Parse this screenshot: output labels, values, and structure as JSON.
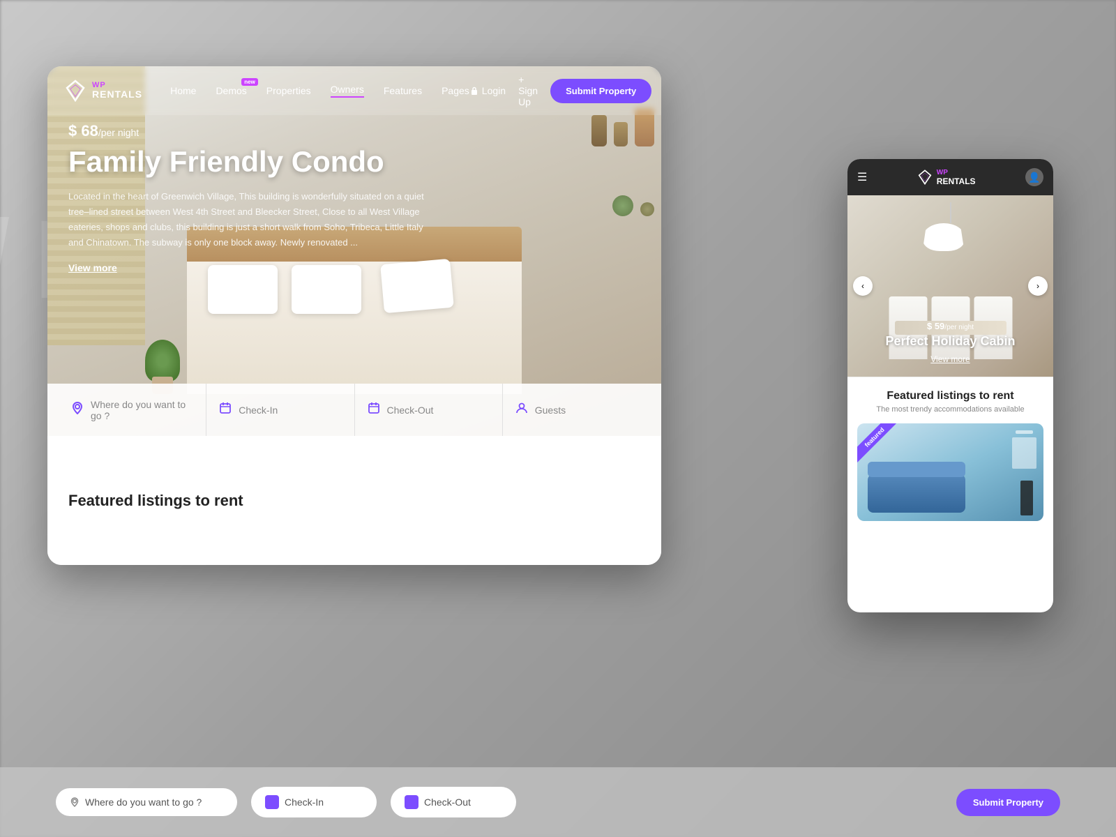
{
  "background": {
    "text": "/ F"
  },
  "nav": {
    "logo": {
      "wp": "WP",
      "rentals": "RENTALS"
    },
    "links": [
      {
        "label": "Home",
        "active": false
      },
      {
        "label": "Demos",
        "active": false,
        "badge": "new"
      },
      {
        "label": "Properties",
        "active": false
      },
      {
        "label": "Owners",
        "active": true
      },
      {
        "label": "Features",
        "active": false
      },
      {
        "label": "Pages",
        "active": false
      }
    ],
    "login_label": "Login",
    "signup_label": "+ Sign Up",
    "submit_label": "Submit Property"
  },
  "hero": {
    "price": "$ 68",
    "price_unit": "/per night",
    "title": "Family Friendly Condo",
    "description": "Located in the heart of Greenwich Village, This building is wonderfully situated on a quiet tree–lined street between West 4th Street and Bleecker Street, Close to all West Village eateries, shops and clubs, this building is just a short walk from Soho, Tribeca, Little Italy and Chinatown. The subway is only one block away. Newly renovated ...",
    "view_more": "View more"
  },
  "search": {
    "location_placeholder": "Where do you want to go ?",
    "checkin_label": "Check-In",
    "checkout_label": "Check-Out",
    "guests_label": "Guests"
  },
  "featured": {
    "title": "Featured listings to rent"
  },
  "mobile": {
    "nav": {
      "wp": "WP",
      "rentals": "RENTALS"
    },
    "hero": {
      "price": "$ 59",
      "price_unit": "/per night",
      "title": "Perfect Holiday Cabin",
      "view_more": "View more"
    },
    "featured": {
      "title": "Featured listings to rent",
      "subtitle": "The most trendy accommodations available",
      "badge": "featured"
    }
  },
  "bottom_bar": {
    "location_placeholder": "Where do you want to go ?",
    "checkin_label": "Check-In",
    "checkout_label": "Check-Out"
  }
}
